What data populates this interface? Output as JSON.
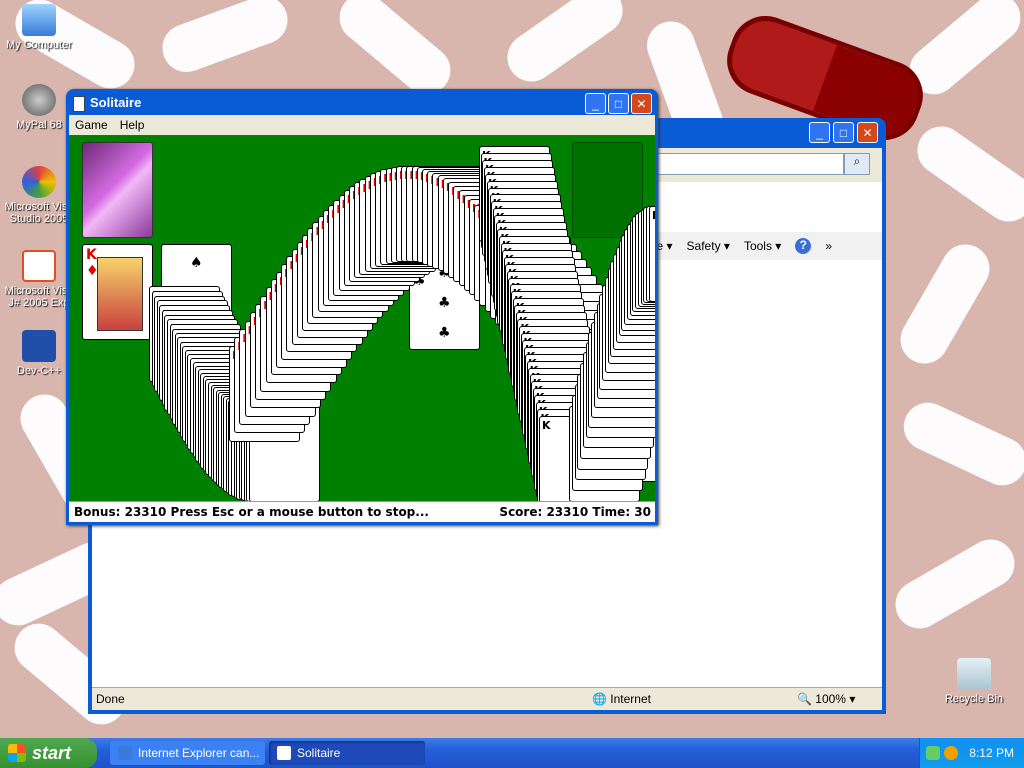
{
  "desktop": {
    "icons": [
      {
        "label": "My Computer",
        "name": "my-computer-icon"
      },
      {
        "label": "MyPal 68",
        "name": "mypal-icon"
      },
      {
        "label": "Microsoft Visu Studio 2005",
        "name": "visual-studio-icon"
      },
      {
        "label": "Microsoft Visu J# 2005 Exp",
        "name": "vj-sharp-icon"
      },
      {
        "label": "Dev-C++",
        "name": "dev-cpp-icon"
      },
      {
        "label": "Recycle Bin",
        "name": "recycle-bin-icon"
      }
    ]
  },
  "ie": {
    "cmd": {
      "page": "Page ▾",
      "safety": "Safety ▾",
      "tools": "Tools ▾",
      "help": "?",
      "more": "»"
    },
    "status": {
      "done": "Done",
      "zone": "Internet",
      "zoom": "100%"
    }
  },
  "solitaire": {
    "title": "Solitaire",
    "menu": [
      "Game",
      "Help"
    ],
    "status_left": "Bonus: 23310  Press Esc or a mouse button to stop...",
    "status_right": "Score: 23310 Time: 30"
  },
  "taskbar": {
    "start": "start",
    "tasks": [
      "Internet Explorer can...",
      "Solitaire"
    ],
    "clock": "8:12 PM"
  },
  "colors": {
    "felt": "#008000",
    "title_bar": "#0a5bd6",
    "taskbar": "#245edb",
    "start": "#37902f"
  }
}
